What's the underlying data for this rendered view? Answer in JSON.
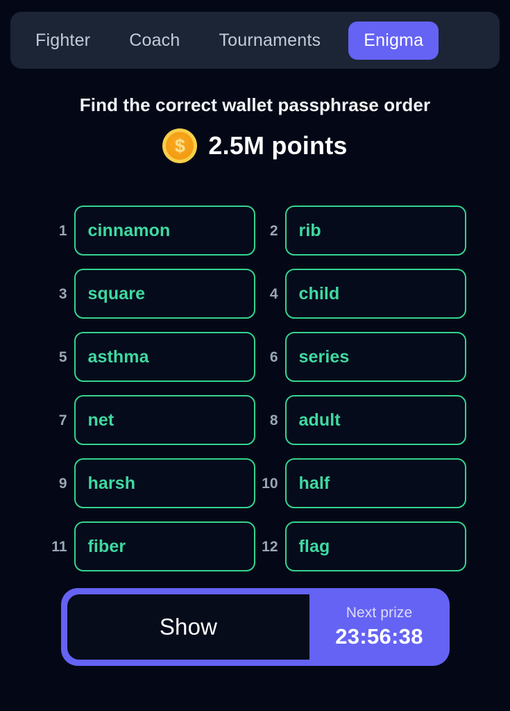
{
  "nav": {
    "tabs": [
      {
        "label": "Fighter",
        "active": false
      },
      {
        "label": "Coach",
        "active": false
      },
      {
        "label": "Tournaments",
        "active": false
      },
      {
        "label": "Enigma",
        "active": true
      }
    ],
    "active_color": "#6563f4",
    "bar_color": "#1c2535",
    "inactive_text_color": "#c3cbd8"
  },
  "header": {
    "title": "Find the correct wallet passphrase order",
    "points_value": "2.5M points",
    "coin_icon": "coin-dollar-icon",
    "coin_symbol": "$",
    "coin_color": "#f39c12"
  },
  "passphrase": {
    "border_color": "#35d48f",
    "text_color": "#3fd9a0",
    "index_color": "#9aa6b8",
    "items": [
      {
        "index": "1",
        "word": "cinnamon"
      },
      {
        "index": "2",
        "word": "rib"
      },
      {
        "index": "3",
        "word": "square"
      },
      {
        "index": "4",
        "word": "child"
      },
      {
        "index": "5",
        "word": "asthma"
      },
      {
        "index": "6",
        "word": "series"
      },
      {
        "index": "7",
        "word": "net"
      },
      {
        "index": "8",
        "word": "adult"
      },
      {
        "index": "9",
        "word": "harsh"
      },
      {
        "index": "10",
        "word": "half"
      },
      {
        "index": "11",
        "word": "fiber"
      },
      {
        "index": "12",
        "word": "flag"
      }
    ]
  },
  "footer": {
    "show_label": "Show",
    "prize_caption": "Next prize",
    "prize_timer": "23:56:38",
    "accent_color": "#6563f4"
  },
  "page": {
    "background_color": "#040816"
  }
}
